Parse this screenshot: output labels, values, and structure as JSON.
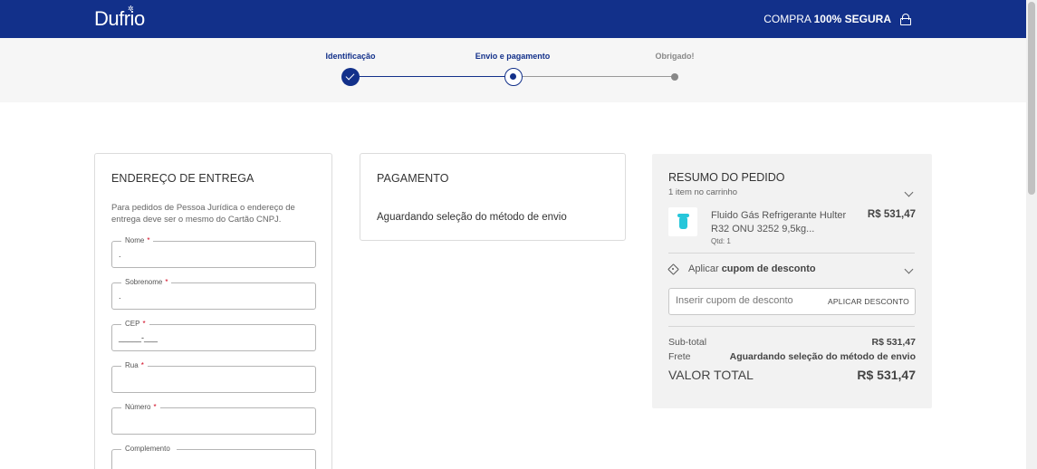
{
  "header": {
    "logo": "Dufrio",
    "secure_prefix": "COMPRA",
    "secure_bold": "100% SEGURA",
    "lock_icon": "lock-icon"
  },
  "stepper": {
    "steps": [
      {
        "label": "Identificação",
        "state": "done"
      },
      {
        "label": "Envio e pagamento",
        "state": "active"
      },
      {
        "label": "Obrigado!",
        "state": "pending"
      }
    ]
  },
  "shipping": {
    "title": "ENDEREÇO DE ENTREGA",
    "note": "Para pedidos de Pessoa Jurídica o endereço de entrega deve ser o mesmo do Cartão CNPJ.",
    "fields": [
      {
        "label": "Nome",
        "required": "*",
        "value": "."
      },
      {
        "label": "Sobrenome",
        "required": "*",
        "value": "."
      },
      {
        "label": "CEP",
        "required": "*",
        "value": "_____-___"
      },
      {
        "label": "Rua",
        "required": "*",
        "value": ""
      },
      {
        "label": "Número",
        "required": "*",
        "value": ""
      },
      {
        "label": "Complemento",
        "required": "",
        "value": ""
      }
    ]
  },
  "payment": {
    "title": "PAGAMENTO",
    "message": "Aguardando seleção do método de envio"
  },
  "summary": {
    "title": "RESUMO DO PEDIDO",
    "count": "1 item no carrinho",
    "product": {
      "name": "Fluido Gás Refrigerante Hulter R32 ONU 3252 9,5kg...",
      "price": "R$ 531,47",
      "qty": "Qtd: 1"
    },
    "coupon": {
      "prefix": "Aplicar",
      "bold": "cupom de desconto",
      "placeholder": "Inserir cupom de desconto",
      "button": "APLICAR DESCONTO"
    },
    "subtotal_label": "Sub-total",
    "subtotal_value": "R$ 531,47",
    "shipping_label": "Frete",
    "shipping_value": "Aguardando seleção do método de envio",
    "total_label": "VALOR TOTAL",
    "total_value": "R$ 531,47"
  },
  "colors": {
    "brand": "#12308a",
    "required": "#d0021b",
    "product": "#26c6da"
  }
}
